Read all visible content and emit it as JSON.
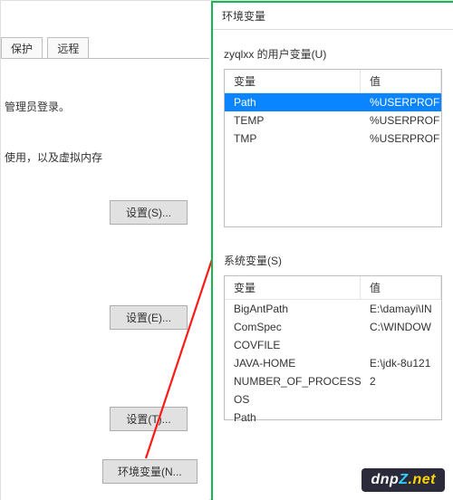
{
  "left": {
    "tabs": {
      "protect": "保护",
      "remote": "远程"
    },
    "admin_login": "管理员登录。",
    "usage_text": "使用，以及虚拟内存",
    "buttons": {
      "settings_s": "设置(S)...",
      "settings_e": "设置(E)...",
      "settings_t": "设置(T)...",
      "env_n": "环境变量(N..."
    }
  },
  "env": {
    "title": "环境变量",
    "user_label": "zyqlxx 的用户变量(U)",
    "sys_label": "系统变量(S)",
    "col_name": "变量",
    "col_val": "值",
    "user_vars": [
      {
        "name": "Path",
        "value": "%USERPROF"
      },
      {
        "name": "TEMP",
        "value": "%USERPROF"
      },
      {
        "name": "TMP",
        "value": "%USERPROF"
      }
    ],
    "sys_vars": [
      {
        "name": "BigAntPath",
        "value": "E:\\damayi\\IN"
      },
      {
        "name": "ComSpec",
        "value": "C:\\WINDOW"
      },
      {
        "name": "COVFILE",
        "value": ""
      },
      {
        "name": "JAVA-HOME",
        "value": "E:\\jdk-8u121"
      },
      {
        "name": "NUMBER_OF_PROCESSORS",
        "value": "2"
      },
      {
        "name": "OS",
        "value": ""
      },
      {
        "name": "Path",
        "value": ""
      }
    ]
  },
  "watermark": {
    "main": "dnp",
    "z": "Z",
    "net": ".net"
  }
}
